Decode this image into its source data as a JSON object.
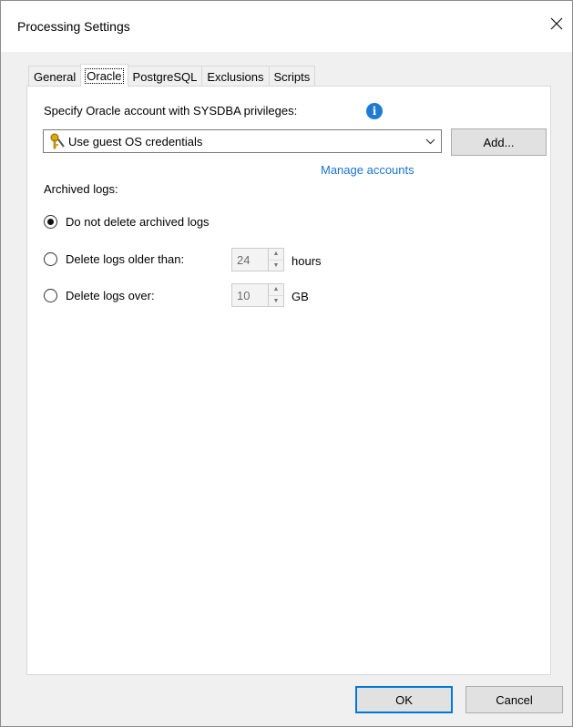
{
  "window": {
    "title": "Processing Settings"
  },
  "tabs": [
    {
      "label": "General"
    },
    {
      "label": "Oracle",
      "active": true
    },
    {
      "label": "PostgreSQL"
    },
    {
      "label": "Exclusions"
    },
    {
      "label": "Scripts"
    }
  ],
  "oracle": {
    "account_label": "Specify Oracle account with SYSDBA privileges:",
    "account_value": "Use guest OS credentials",
    "add_label": "Add...",
    "manage_label": "Manage accounts",
    "archived_label": "Archived logs:",
    "options": [
      {
        "label": "Do not delete archived logs",
        "checked": true
      },
      {
        "label": "Delete logs older than:",
        "checked": false,
        "value": "24",
        "unit": "hours"
      },
      {
        "label": "Delete logs over:",
        "checked": false,
        "value": "10",
        "unit": "GB"
      }
    ]
  },
  "footer": {
    "ok_label": "OK",
    "cancel_label": "Cancel"
  },
  "colors": {
    "accent": "#0078d7",
    "link": "#1a74d1",
    "info": "#1f7ad4"
  }
}
